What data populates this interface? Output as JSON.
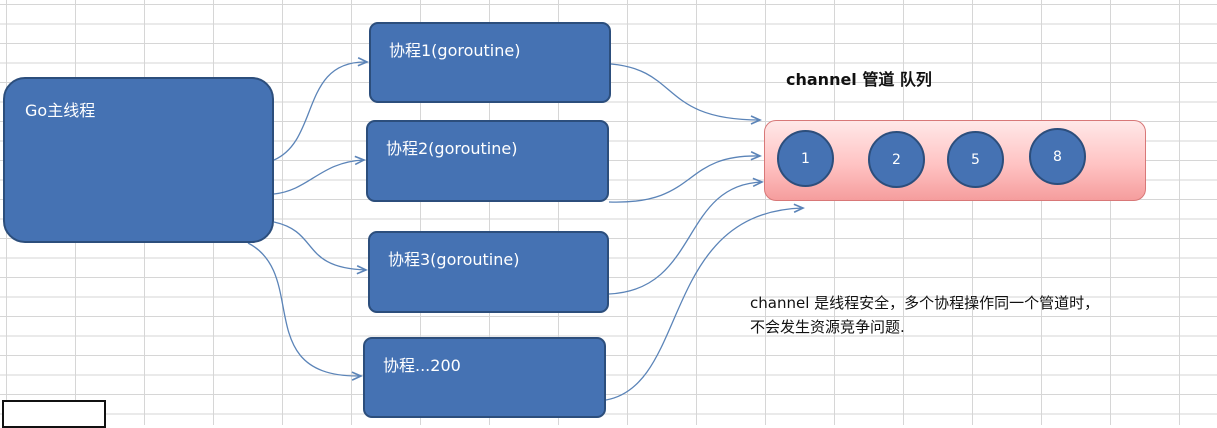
{
  "diagram": {
    "main_thread": {
      "label": "Go主线程"
    },
    "goroutines": [
      {
        "label": "协程1(goroutine)"
      },
      {
        "label": "协程2(goroutine)"
      },
      {
        "label": "协程3(goroutine)"
      },
      {
        "label": "协程...200"
      }
    ],
    "channel": {
      "title": "channel 管道 队列",
      "items": [
        "1",
        "2",
        "5",
        "8"
      ]
    },
    "note": {
      "line1": "channel 是线程安全，多个协程操作同一个管道时，",
      "line2": "不会发生资源竞争问题."
    }
  },
  "colors": {
    "box_fill": "#4572b3",
    "box_border": "#2c4e7c",
    "arrow": "#5b84b8",
    "queue_fill": "#ffc3c3",
    "queue_border": "#d87878"
  }
}
